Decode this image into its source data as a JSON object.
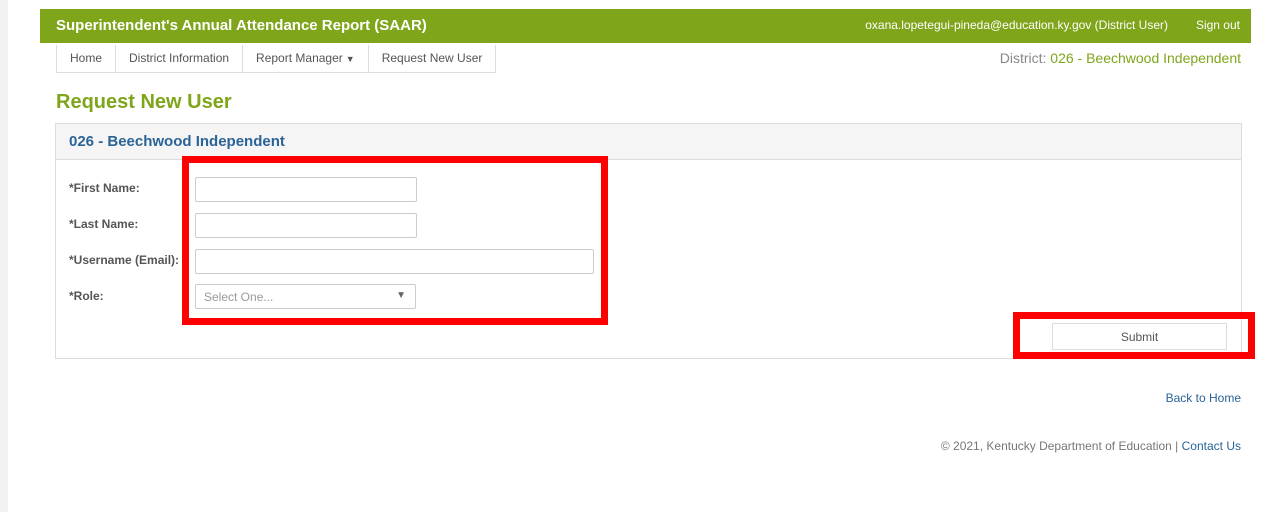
{
  "header": {
    "title": "Superintendent's Annual Attendance Report (SAAR)",
    "user_email": "oxana.lopetegui-pineda@education.ky.gov (District User)",
    "signout_label": "Sign out"
  },
  "nav": {
    "items": [
      {
        "label": "Home"
      },
      {
        "label": "District Information"
      },
      {
        "label": "Report Manager",
        "icon": "caret-down-icon"
      },
      {
        "label": "Request New User"
      }
    ]
  },
  "district": {
    "prefix": "District:",
    "value": "026 - Beechwood Independent"
  },
  "page_title": "Request New User",
  "panel": {
    "header": "026 - Beechwood Independent"
  },
  "form": {
    "first_name_label": "*First Name:",
    "first_name_value": "",
    "last_name_label": "*Last Name:",
    "last_name_value": "",
    "username_label": "*Username (Email):",
    "username_value": "",
    "role_label": "*Role:",
    "role_selected": "Select One...",
    "submit_label": "Submit"
  },
  "links": {
    "back_home": "Back to Home"
  },
  "footer": {
    "copyright": "© 2021, Kentucky Department of Education |",
    "contact_label": "Contact Us"
  },
  "colors": {
    "brand_green": "#7fa51b",
    "link_blue": "#2a6496",
    "highlight_red": "#ff0000"
  }
}
